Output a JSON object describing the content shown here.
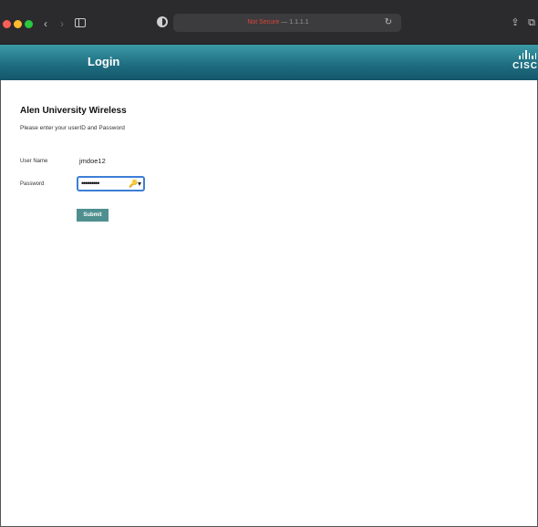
{
  "browser": {
    "address_warning": "Not Secure",
    "address_host": "— 1.1.1.1",
    "back_icon": "chevron-left-icon",
    "forward_icon": "chevron-right-icon",
    "reload_icon": "reload-icon",
    "back_glyph": "‹",
    "forward_glyph": "›",
    "reload_glyph": "↻",
    "share_glyph": "⇪",
    "tabs_glyph": "⧉"
  },
  "portal": {
    "title": "Login",
    "logo_text": "CISC",
    "header_colors": [
      "#3c9aa6",
      "#14566a"
    ]
  },
  "form": {
    "heading": "Alen University Wireless",
    "instructions": "Please enter your userID and Password",
    "username_label": "User Name",
    "username_value": "jmdoe12",
    "password_label": "Password",
    "password_value": "•••••••••",
    "password_key_glyph": "🔑▾",
    "submit_label": "Submit"
  }
}
